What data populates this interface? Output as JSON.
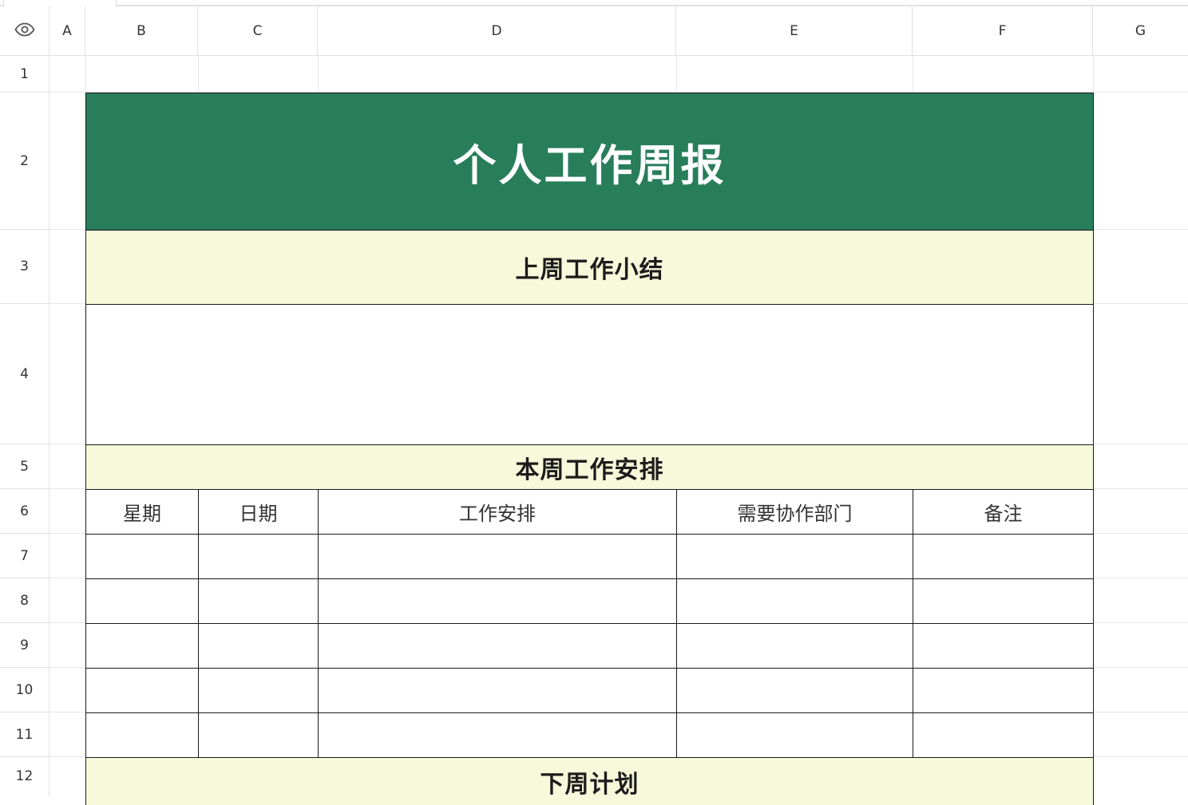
{
  "columns": [
    "A",
    "B",
    "C",
    "D",
    "E",
    "F",
    "G"
  ],
  "rows": [
    "1",
    "2",
    "3",
    "4",
    "5",
    "6",
    "7",
    "8",
    "9",
    "10",
    "11",
    "12"
  ],
  "corner_icon": "eye-icon",
  "sheet": {
    "title": "个人工作周报",
    "last_week_header": "上周工作小结",
    "last_week_content": "",
    "this_week_header": "本周工作安排",
    "table_headers": [
      "星期",
      "日期",
      "工作安排",
      "需要协作部门",
      "备注"
    ],
    "table_rows": [
      [
        "",
        "",
        "",
        "",
        ""
      ],
      [
        "",
        "",
        "",
        "",
        ""
      ],
      [
        "",
        "",
        "",
        "",
        ""
      ],
      [
        "",
        "",
        "",
        "",
        ""
      ],
      [
        "",
        "",
        "",
        "",
        ""
      ]
    ],
    "next_week_header": "下周计划"
  },
  "colors": {
    "title_fill": "#287d5a",
    "section_fill": "#f6f9da",
    "border": "#1a1a1a"
  }
}
